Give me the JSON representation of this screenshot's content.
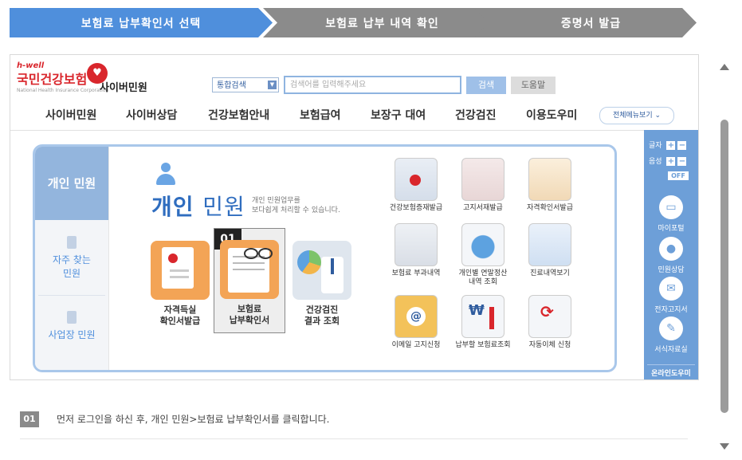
{
  "steps": [
    {
      "label": "보험료 납부확인서 선택",
      "active": true
    },
    {
      "label": "보험료 납부 내역 확인",
      "active": false
    },
    {
      "label": "증명서 발급",
      "active": false
    }
  ],
  "header": {
    "logo_hwell": "h-well",
    "logo_name": "국민건강보험",
    "logo_eng": "National Health Insurance Corporation",
    "site_title": "사이버민원",
    "search_scope": "통합검색",
    "search_placeholder": "검색어를 입력해주세요",
    "search_button": "검색",
    "help_button": "도움말"
  },
  "gnb": {
    "items": [
      "사이버민원",
      "사이버상담",
      "건강보험안내",
      "보험급여",
      "보장구 대여",
      "건강검진",
      "이용도우미"
    ],
    "all_menu": "전체메뉴보기"
  },
  "left_nav": {
    "active": "개인 민원",
    "faq": "자주 찾는\n민원",
    "workplace": "사업장 민원"
  },
  "main": {
    "title_a": "개인",
    "title_b": "민원",
    "desc": "개인 민원업무를\n보다쉽게 처리할 수 있습니다.",
    "badge": "01",
    "cards": [
      {
        "label": "자격득실\n확인서발급",
        "icon": "clipboard-icon"
      },
      {
        "label": "보험료\n납부확인서",
        "icon": "document-glasses-icon"
      },
      {
        "label": "건강검진\n결과 조회",
        "icon": "doctor-chart-icon"
      }
    ],
    "minis": [
      {
        "label": "건강보험증재발급",
        "icon": "insurance-card-icon"
      },
      {
        "label": "고지서재발급",
        "icon": "bill-icon"
      },
      {
        "label": "자격확인서발급",
        "icon": "certificate-icon"
      },
      {
        "label": "보험료 부과내역",
        "icon": "calculator-icon"
      },
      {
        "label": "개인별 연말정산\n내역 조회",
        "icon": "pie-chart-icon"
      },
      {
        "label": "진료내역보기",
        "icon": "stethoscope-icon"
      },
      {
        "label": "이메일 고지신청",
        "icon": "email-icon"
      },
      {
        "label": "납부할 보험료조회",
        "icon": "won-chart-icon"
      },
      {
        "label": "자동이체 신청",
        "icon": "auto-transfer-icon"
      }
    ]
  },
  "quickbar": {
    "font_label": "글자",
    "sound_label": "음성",
    "plus": "+",
    "minus": "−",
    "off": "OFF",
    "items": [
      "마이포털",
      "민원상담",
      "전자고지서",
      "서식자료실"
    ],
    "online": "온라인도우미"
  },
  "instruction": {
    "number": "01",
    "text": "먼저 로그인을 하신 후, 개인 민원>보험료 납부확인서를 클릭합니다."
  },
  "colors": {
    "step_active": "#4f8fdc",
    "step_inactive": "#8b8b8b",
    "brand_red": "#d9262c",
    "quickbar_blue": "#6d9fd8"
  }
}
